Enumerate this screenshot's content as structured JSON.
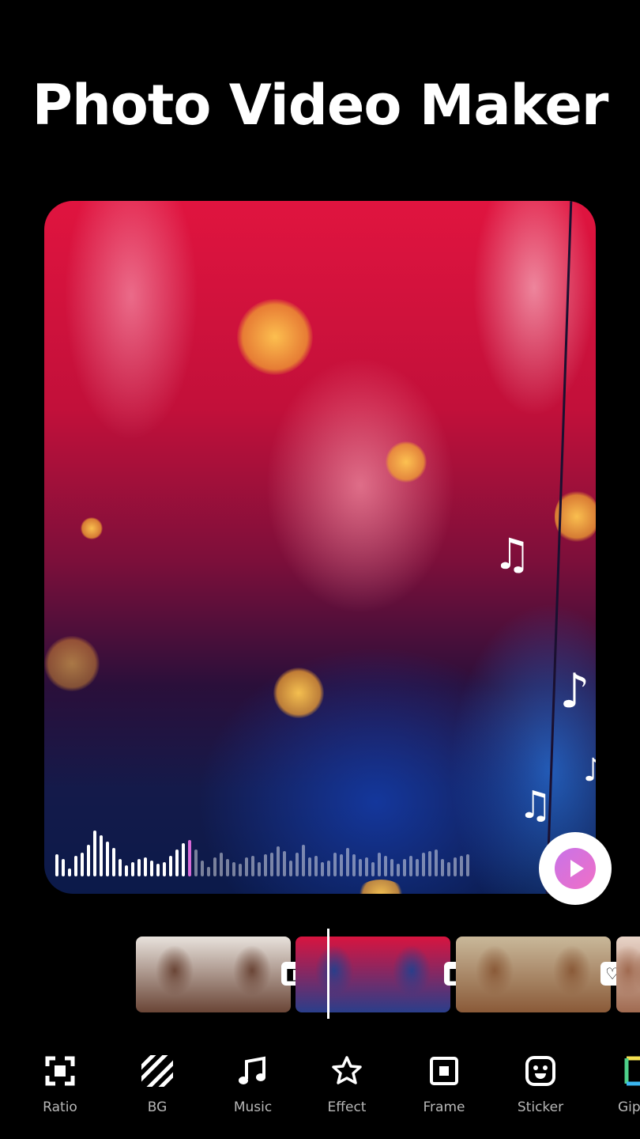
{
  "header": {
    "title": "Photo Video Maker"
  },
  "preview": {
    "description": "Woman in neon-lit street scene with bokeh",
    "music_notes": [
      "music-note",
      "music-note",
      "music-note",
      "music-note"
    ],
    "waveform": {
      "played_bars": [
        28,
        22,
        10,
        26,
        30,
        40,
        58,
        52,
        44,
        36,
        22,
        14,
        18,
        22,
        24,
        20,
        16,
        18,
        26,
        34,
        42,
        46
      ],
      "remaining_bars": [
        34,
        20,
        12,
        24,
        30,
        22,
        18,
        16,
        24,
        26,
        18,
        28,
        30,
        38,
        32,
        20,
        30,
        40,
        24,
        26,
        18,
        20,
        30,
        28,
        36,
        28,
        22,
        24,
        18,
        30,
        26,
        22,
        16,
        22,
        26,
        22,
        30,
        32,
        34,
        22,
        18,
        24,
        26,
        28
      ],
      "progress_fraction": 0.34
    },
    "play_button": {
      "icon": "play-icon"
    }
  },
  "timeline": {
    "clips": [
      {
        "name": "clip-1",
        "colors": [
          "#e8e2dc",
          "#6a4536"
        ]
      },
      {
        "name": "clip-2",
        "colors": [
          "#d8143f",
          "#2a3e8a"
        ]
      },
      {
        "name": "clip-3",
        "colors": [
          "#c9b89a",
          "#8a5a38"
        ]
      },
      {
        "name": "clip-4",
        "colors": [
          "#e8d4c8",
          "#a06a50"
        ]
      }
    ],
    "transitions": [
      {
        "icon": "transition-icon",
        "glyph": "◧"
      },
      {
        "icon": "transition-icon",
        "glyph": "◧"
      },
      {
        "icon": "heart-icon",
        "glyph": "♡"
      }
    ]
  },
  "toolbar": {
    "items": [
      {
        "label": "Ratio",
        "icon": "ratio-icon"
      },
      {
        "label": "BG",
        "icon": "background-icon"
      },
      {
        "label": "Music",
        "icon": "music-icon"
      },
      {
        "label": "Effect",
        "icon": "star-icon"
      },
      {
        "label": "Frame",
        "icon": "frame-icon"
      },
      {
        "label": "Sticker",
        "icon": "sticker-icon"
      },
      {
        "label": "Giphy",
        "icon": "giphy-icon"
      }
    ]
  }
}
